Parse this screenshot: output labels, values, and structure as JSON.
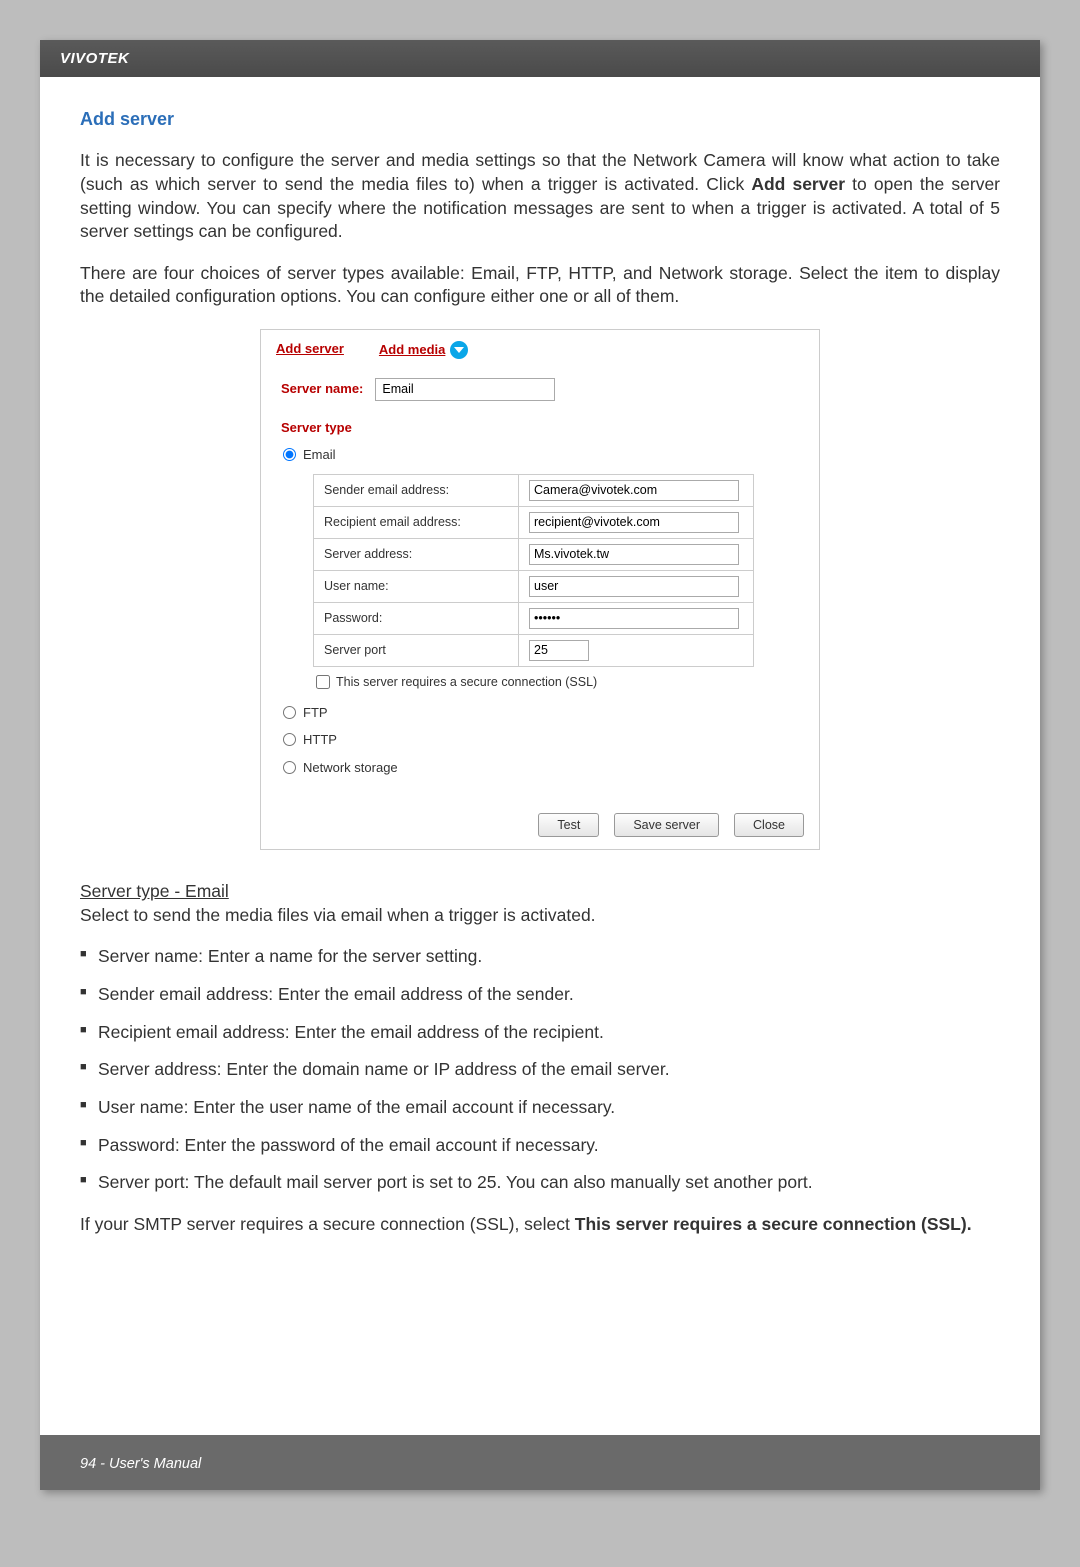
{
  "header": {
    "brand": "VIVOTEK"
  },
  "section": {
    "title": "Add server",
    "intro1": "It is necessary to configure the server and media settings so that the Network Camera will know what action to take (such as which server to send the media files to) when a trigger is activated. Click Add server to open the server setting window. You can specify where the notification messages are sent to when a trigger is activated. A total of 5 server settings can be configured.",
    "intro2": "There are four choices of server types available: Email, FTP, HTTP, and Network storage. Select the item to display the detailed configuration options. You can configure either one or all of them."
  },
  "dialog": {
    "tabs": {
      "add_server": "Add server",
      "add_media": "Add media"
    },
    "server_name_label": "Server name:",
    "server_name_value": "Email",
    "server_type_label": "Server type",
    "options": {
      "email": "Email",
      "ftp": "FTP",
      "http": "HTTP",
      "network_storage": "Network storage"
    },
    "email_fields": {
      "sender_label": "Sender email address:",
      "sender_value": "Camera@vivotek.com",
      "recipient_label": "Recipient email address:",
      "recipient_value": "recipient@vivotek.com",
      "server_address_label": "Server address:",
      "server_address_value": "Ms.vivotek.tw",
      "user_name_label": "User name:",
      "user_name_value": "user",
      "password_label": "Password:",
      "password_value": "••••••",
      "server_port_label": "Server port",
      "server_port_value": "25",
      "ssl_label": "This server requires a secure connection (SSL)"
    },
    "buttons": {
      "test": "Test",
      "save": "Save server",
      "close": "Close"
    }
  },
  "subsection": {
    "heading": "Server type - Email",
    "desc": "Select to send the media files via email when a trigger is activated.",
    "bullets": [
      "Server name: Enter a name for the server setting.",
      "Sender email address: Enter the email address of the sender.",
      "Recipient email address: Enter the email address of the recipient.",
      "Server address: Enter the domain name or IP address of the email server.",
      "User name: Enter the user name of the email account if necessary.",
      "Password: Enter the password of the email account if necessary.",
      "Server port: The default mail server port is set to 25. You can also manually set another port."
    ],
    "final": "If your SMTP server requires a secure connection (SSL), select This server requires a secure connection (SSL)."
  },
  "footer": {
    "text": "94 - User's Manual"
  }
}
